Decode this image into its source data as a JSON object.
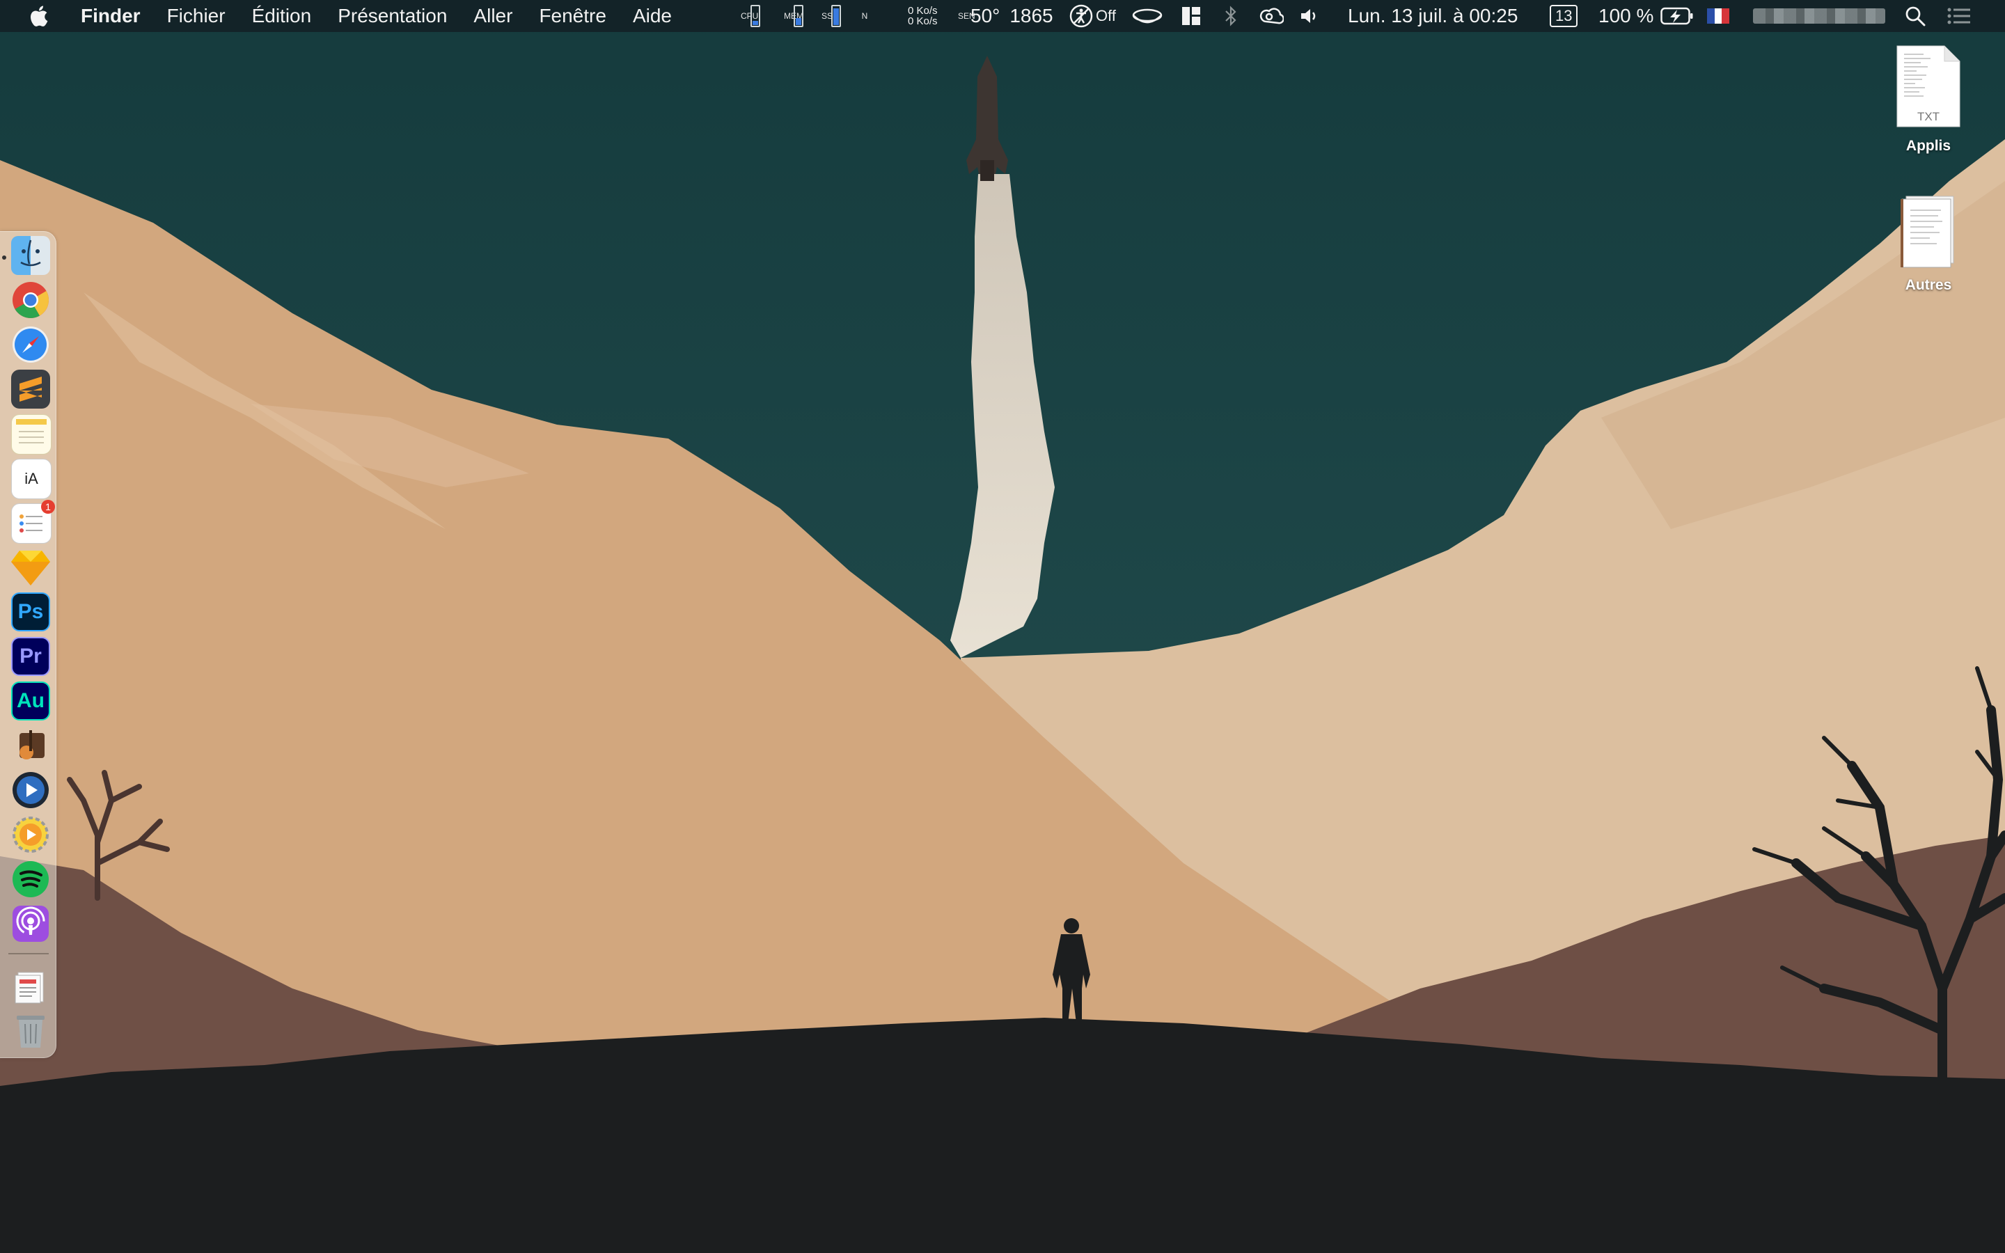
{
  "menubar": {
    "app_name": "Finder",
    "menus": [
      "Fichier",
      "Édition",
      "Présentation",
      "Aller",
      "Fenêtre",
      "Aide"
    ],
    "status": {
      "cpu_label": "CPU",
      "mem_label": "MEM",
      "ssd_label": "SSD",
      "net_label": "N",
      "net_up": "0 Ko/s",
      "net_down": "0 Ko/s",
      "sensor_label": "SEN",
      "temperature": "50°",
      "fan_rpm": "1865",
      "caffeine_state": "Off",
      "datetime": "Lun. 13 juil. à  00:25",
      "calendar_day": "13",
      "battery": "100 %"
    },
    "icons": [
      "apple-icon",
      "cpu-gauge-icon",
      "memory-gauge-icon",
      "ssd-gauge-icon",
      "accessibility-icon",
      "cup-icon",
      "magnet-icon",
      "bluetooth-icon",
      "creative-cloud-icon",
      "volume-icon",
      "battery-charging-icon",
      "france-flag-icon",
      "search-icon",
      "notification-center-icon"
    ]
  },
  "dock": {
    "apps": [
      {
        "name": "Finder",
        "icon": "finder-icon",
        "running": true
      },
      {
        "name": "Google Chrome",
        "icon": "chrome-icon"
      },
      {
        "name": "Safari",
        "icon": "safari-icon"
      },
      {
        "name": "Sublime Text",
        "icon": "sublime-text-icon"
      },
      {
        "name": "Notes",
        "icon": "notes-icon"
      },
      {
        "name": "iA Writer",
        "icon": "ia-writer-icon",
        "label": "iA"
      },
      {
        "name": "Reminders",
        "icon": "reminders-icon",
        "badge": "1"
      },
      {
        "name": "Sketch",
        "icon": "sketch-icon"
      },
      {
        "name": "Photoshop",
        "icon": "photoshop-icon",
        "label": "Ps"
      },
      {
        "name": "Premiere Pro",
        "icon": "premiere-pro-icon",
        "label": "Pr"
      },
      {
        "name": "Audition",
        "icon": "audition-icon",
        "label": "Au"
      },
      {
        "name": "GarageBand",
        "icon": "garageband-icon"
      },
      {
        "name": "QuickTime / Player",
        "icon": "media-player-icon"
      },
      {
        "name": "Infuse",
        "icon": "infuse-icon"
      },
      {
        "name": "Spotify",
        "icon": "spotify-icon"
      },
      {
        "name": "Podcasts",
        "icon": "podcasts-icon"
      },
      {
        "name": "Documents",
        "icon": "documents-stack-icon"
      },
      {
        "name": "Corbeille",
        "icon": "trash-icon"
      }
    ]
  },
  "desktop": {
    "items": [
      {
        "label": "Applis",
        "kind": "TXT"
      },
      {
        "label": "Autres",
        "kind": ""
      }
    ]
  },
  "colors": {
    "sky": "#1f4a4c",
    "mountain_light": "#d9b692",
    "mountain_mid": "#c99f78",
    "hill_brown": "#6e4f45",
    "ground": "#1c1e1f"
  }
}
